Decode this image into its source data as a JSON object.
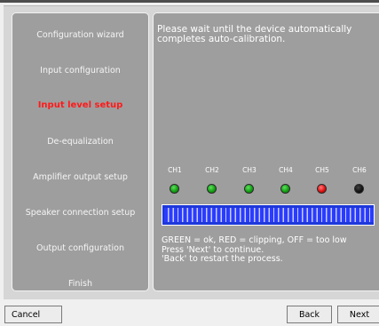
{
  "wizard": {
    "steps": [
      {
        "label": "Configuration wizard",
        "active": false
      },
      {
        "label": "Input configuration",
        "active": false
      },
      {
        "label": "Input level setup",
        "active": true
      },
      {
        "label": "De-equalization",
        "active": false
      },
      {
        "label": "Amplifier output setup",
        "active": false
      },
      {
        "label": "Speaker connection setup",
        "active": false
      },
      {
        "label": "Output configuration",
        "active": false
      },
      {
        "label": "Finish",
        "active": false
      }
    ]
  },
  "main": {
    "message": "Please wait until the device automatically completes auto-calibration.",
    "channels": [
      {
        "label": "CH1",
        "status": "green"
      },
      {
        "label": "CH2",
        "status": "green"
      },
      {
        "label": "CH3",
        "status": "green"
      },
      {
        "label": "CH4",
        "status": "green"
      },
      {
        "label": "CH5",
        "status": "red"
      },
      {
        "label": "CH6",
        "status": "off"
      }
    ],
    "progress": 1.0,
    "legend_line1": "GREEN = ok, RED = clipping, OFF = too low",
    "legend_line2": "Press 'Next' to continue.",
    "legend_line3": "'Back' to restart the process."
  },
  "buttons": {
    "cancel": "Cancel",
    "back": "Back",
    "next": "Next"
  },
  "colors": {
    "active_step": "#ff1a1a",
    "meter": "#1d38d9",
    "led_green": "#13a013",
    "led_red": "#e01010",
    "led_off": "#000000"
  }
}
